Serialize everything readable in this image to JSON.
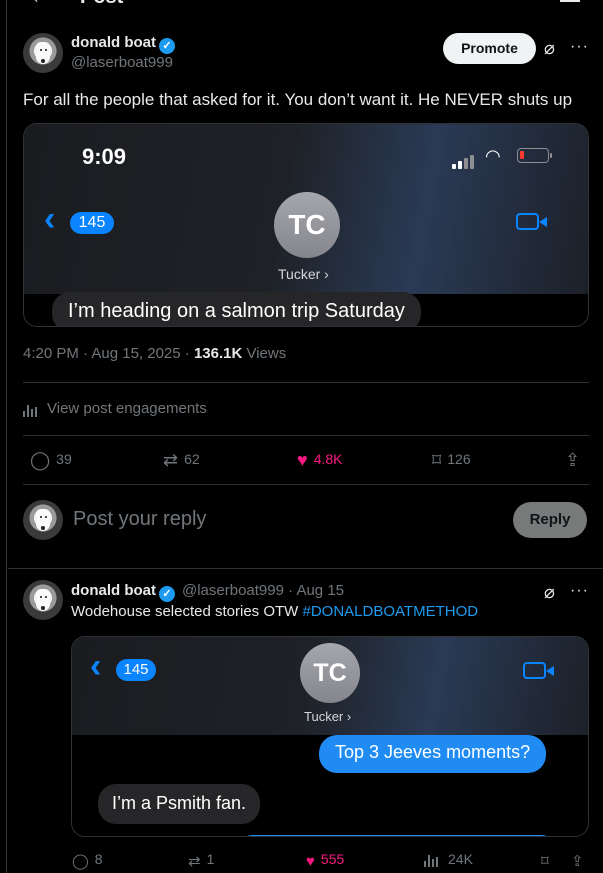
{
  "header": {
    "back_glyph": "←",
    "title": "Post"
  },
  "main_post": {
    "display_name": "donald boat",
    "handle": "@laserboat999",
    "promote_label": "Promote",
    "text": "For all the people that asked for it. You don’t want it. He NEVER shuts up",
    "media": {
      "status_time": "9:09",
      "back_count": "145",
      "contact_initials": "TC",
      "contact_name": "Tucker ›",
      "message": "I’m heading on a salmon trip Saturday"
    },
    "meta_time": "4:20 PM · Aug 15, 2025 · ",
    "meta_views_count": "136.1K",
    "meta_views_label": " Views",
    "engagements_label": "View post engagements",
    "stats": {
      "replies": "39",
      "reposts": "62",
      "likes": "4.8K",
      "bookmarks": "126"
    }
  },
  "reply_box": {
    "placeholder": "Post your reply",
    "button_label": "Reply"
  },
  "second_post": {
    "display_name": "donald boat",
    "handle_time": "@laserboat999 · Aug 15",
    "text": "Wodehouse selected stories OTW ",
    "hashtag": "#DONALDBOATMETHOD",
    "media": {
      "back_count": "145",
      "contact_initials": "TC",
      "contact_name": "Tucker ›",
      "sent_message": "Top 3 Jeeves moments?",
      "received_message": "I’m a Psmith fan."
    },
    "stats": {
      "replies": "8",
      "reposts": "1",
      "likes": "555",
      "views": "24K"
    }
  },
  "colors": {
    "accent": "#1d9bf0",
    "like": "#f91880",
    "imessage_blue": "#0a84ff",
    "muted": "#71767b"
  }
}
